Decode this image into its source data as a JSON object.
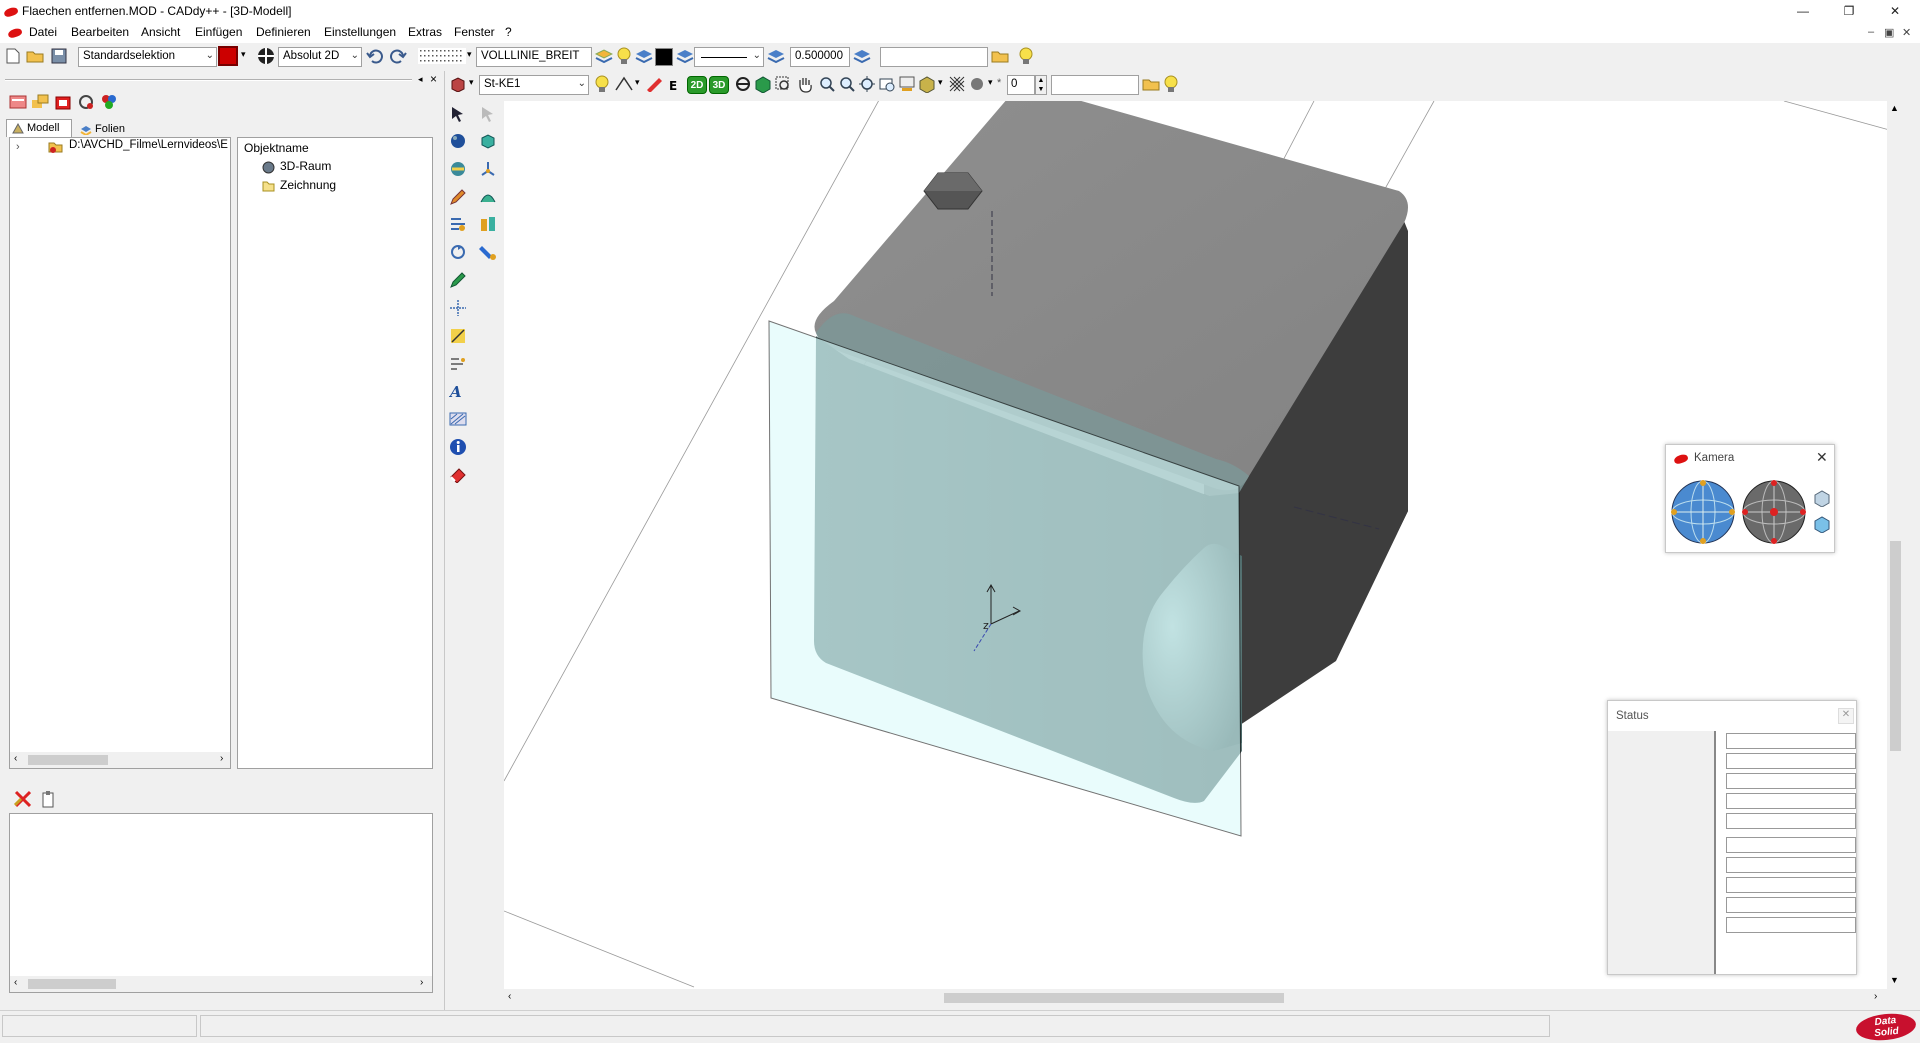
{
  "window": {
    "title": "Flaechen entfernen.MOD  -  CADdy++ - [3D-Modell]",
    "controls": {
      "minimize": "—",
      "restore": "❐",
      "close": "✕"
    },
    "mdi_controls": {
      "minimize": "–",
      "restore": "▣",
      "close": "✕"
    }
  },
  "menu": [
    "Datei",
    "Bearbeiten",
    "Ansicht",
    "Einfügen",
    "Definieren",
    "Einstellungen",
    "Extras",
    "Fenster",
    "?"
  ],
  "toolbar1": {
    "selection_mode": "Standardselektion",
    "coordinate_mode": "Absolut 2D",
    "line_type": "VOLLLINIE_BREIT",
    "line_width": "0.500000",
    "color_swatch": "#000000"
  },
  "toolbar2": {
    "material": "St-KE1",
    "btn_2d": "2D",
    "btn_3d": "3D",
    "counter_value": "0",
    "counter_prefix": "*"
  },
  "left_panel": {
    "tabs": [
      "Modell",
      "Folien"
    ],
    "tree_path": "D:\\AVCHD_Filme\\Lernvideos\\E",
    "objects_header": "Objektname",
    "objects": [
      "3D-Raum",
      "Zeichnung"
    ]
  },
  "camera_panel": {
    "title": "Kamera"
  },
  "status_panel": {
    "title": "Status",
    "rows": [
      "",
      "",
      "",
      "",
      "",
      "",
      "",
      "",
      "",
      ""
    ]
  },
  "brand": {
    "logo_line1": "Data",
    "logo_line2": "Solid",
    "accent": "#c8102e"
  },
  "colors": {
    "cube_top": "#8a8a8a",
    "cube_side": "#3c3c3c",
    "cube_front": "#5f7a7a",
    "section_plane": "#e0fbfb"
  }
}
